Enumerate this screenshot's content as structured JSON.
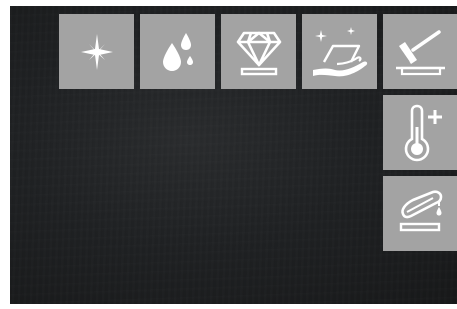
{
  "toolbar": {
    "buttons": [
      {
        "name": "sparkle-mode-button",
        "icon": "sparkle-icon"
      },
      {
        "name": "drops-mode-button",
        "icon": "water-drops-icon"
      },
      {
        "name": "diamond-mode-button",
        "icon": "diamond-icon"
      },
      {
        "name": "hand-sparkle-mode-button",
        "icon": "hand-glass-sparkle-icon"
      },
      {
        "name": "scraper-mode-button",
        "icon": "scraper-icon"
      }
    ]
  },
  "side_panel": {
    "buttons": [
      {
        "name": "temperature-up-button",
        "icon": "thermometer-plus-icon"
      },
      {
        "name": "oil-dispense-button",
        "icon": "oil-drip-icon"
      }
    ]
  },
  "colors": {
    "button_bg": "#a3a3a3",
    "icon": "#ffffff",
    "screen_bg": "#1f2123"
  }
}
